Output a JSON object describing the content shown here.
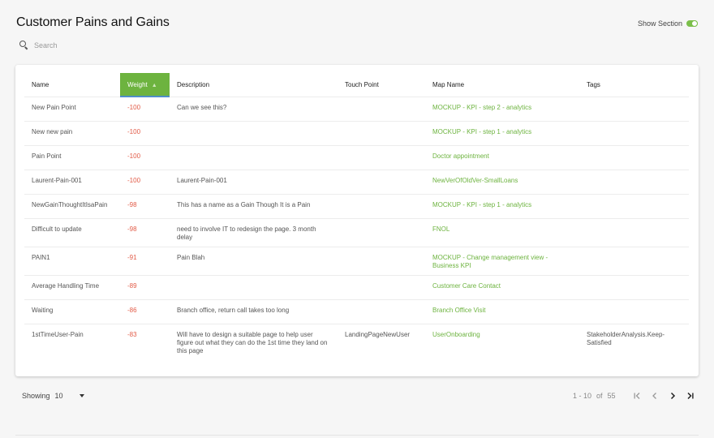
{
  "header": {
    "title": "Customer Pains and Gains",
    "show_section_label": "Show Section",
    "show_section_on": true
  },
  "search": {
    "placeholder": "Search",
    "value": ""
  },
  "table": {
    "columns": {
      "name": "Name",
      "weight": "Weight",
      "description": "Description",
      "touch_point": "Touch Point",
      "map_name": "Map Name",
      "tags": "Tags"
    },
    "sort_column": "weight",
    "sort_direction": "ascending",
    "rows": [
      {
        "name": "New Pain Point",
        "weight": "-100",
        "description": "Can we see this?",
        "touch_point": "",
        "map_name": "MOCKUP - KPI - step 2 - analytics",
        "tags": ""
      },
      {
        "name": "New new pain",
        "weight": "-100",
        "description": "",
        "touch_point": "",
        "map_name": "MOCKUP - KPI - step 1 - analytics",
        "tags": ""
      },
      {
        "name": "Pain Point",
        "weight": "-100",
        "description": "",
        "touch_point": "",
        "map_name": "Doctor appointment",
        "tags": ""
      },
      {
        "name": "Laurent-Pain-001",
        "weight": "-100",
        "description": "Laurent-Pain-001",
        "touch_point": "",
        "map_name": "NewVerOfOldVer-SmallLoans",
        "tags": ""
      },
      {
        "name": "NewGainThoughtItIsaPain",
        "weight": "-98",
        "description": "This has a name as a Gain Though It is a Pain",
        "touch_point": "",
        "map_name": "MOCKUP - KPI - step 1 - analytics",
        "tags": ""
      },
      {
        "name": "Difficult to update",
        "weight": "-98",
        "description": "need to involve IT to redesign the page. 3 month delay",
        "touch_point": "",
        "map_name": "FNOL",
        "tags": ""
      },
      {
        "name": "PAIN1",
        "weight": "-91",
        "description": "Pain Blah",
        "touch_point": "",
        "map_name": "MOCKUP - Change management view - Business KPI",
        "tags": ""
      },
      {
        "name": "Average Handling Time",
        "weight": "-89",
        "description": "",
        "touch_point": "",
        "map_name": "Customer Care Contact",
        "tags": ""
      },
      {
        "name": "Waiting",
        "weight": "-86",
        "description": "Branch office, return call takes too long",
        "touch_point": "",
        "map_name": "Branch Office Visit",
        "tags": ""
      },
      {
        "name": "1stTimeUser-Pain",
        "weight": "-83",
        "description": "Will have to design a suitable page to help user figure out what they can do the 1st time they land on this page",
        "touch_point": "LandingPageNewUser",
        "map_name": "UserOnboarding",
        "tags": "StakeholderAnalysis.Keep-Satisfied"
      }
    ]
  },
  "footer": {
    "showing_label": "Showing",
    "page_size": "10",
    "range": "1 - 10",
    "of_label": "of",
    "total": "55"
  },
  "icons": {
    "search": "search-icon",
    "sort": "sort-arrow-up-icon",
    "dropdown": "caret-down-icon",
    "first": "first-page-icon",
    "prev": "chevron-left-icon",
    "next": "chevron-right-icon",
    "last": "last-page-icon"
  },
  "colors": {
    "accent": "#6db33f",
    "weight_negative": "#e25b47",
    "sort_underline": "#4f8ec9"
  }
}
